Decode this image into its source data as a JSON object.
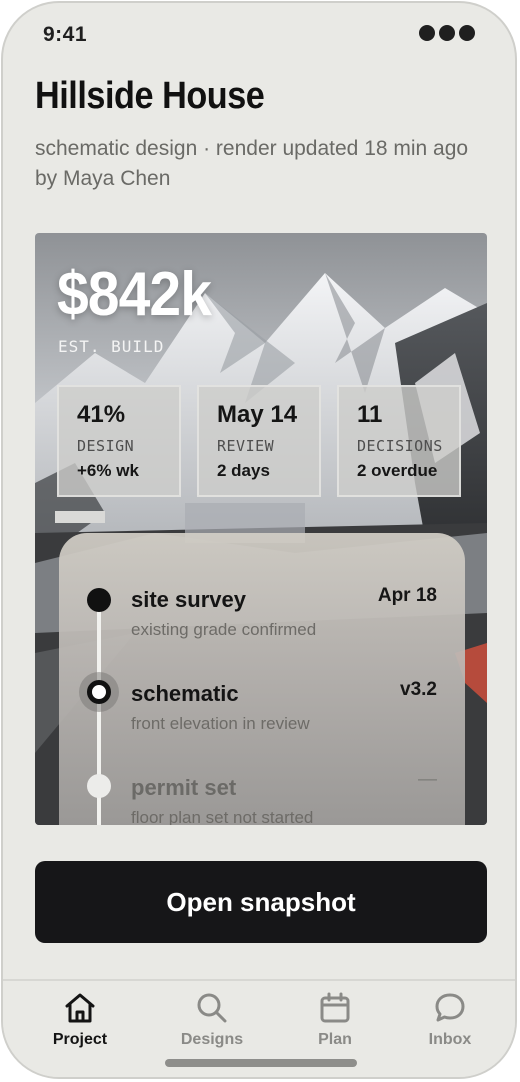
{
  "status": {
    "time": "9:41"
  },
  "project": {
    "title": "Hillside House",
    "subtitle": "schematic design · render updated 18 min ago by Maya Chen"
  },
  "hero": {
    "amount": "$842k",
    "amount_label": "EST. BUILD",
    "stats": [
      {
        "value": "41%",
        "label": "DESIGN",
        "detail": "+6% wk"
      },
      {
        "value": "May 14",
        "label": "REVIEW",
        "detail": "2 days"
      },
      {
        "value": "11",
        "label": "DECISIONS",
        "detail": "2 overdue"
      }
    ]
  },
  "timeline": [
    {
      "title": "site survey",
      "subtitle": "existing grade confirmed",
      "meta": "Apr 18",
      "state": "done"
    },
    {
      "title": "schematic",
      "subtitle": "front elevation in review",
      "meta": "v3.2",
      "state": "current"
    },
    {
      "title": "permit set",
      "subtitle": "floor plan set not started",
      "meta": "—",
      "state": "pending"
    }
  ],
  "cta": {
    "label": "Open snapshot"
  },
  "tabs": [
    {
      "label": "Project",
      "icon": "home-icon",
      "active": true
    },
    {
      "label": "Designs",
      "icon": "search-icon",
      "active": false
    },
    {
      "label": "Plan",
      "icon": "calendar-icon",
      "active": false
    },
    {
      "label": "Inbox",
      "icon": "chat-bubble-icon",
      "active": false
    }
  ],
  "colors": {
    "background": "#e9e9e5",
    "cta": "#161618",
    "text": "#111111",
    "muted": "#6a6a66"
  }
}
